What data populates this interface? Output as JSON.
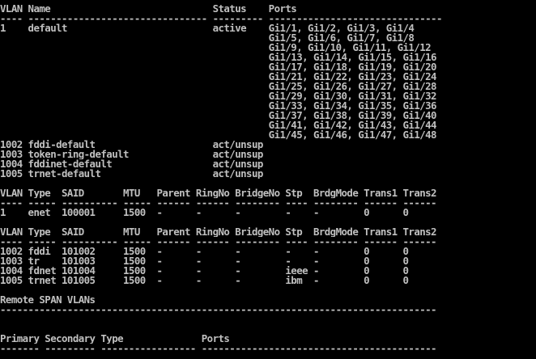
{
  "terminal": {
    "lines": [
      "VLAN Name                             Status    Ports",
      "---- -------------------------------- --------- -------------------------------",
      "1    default                          active    Gi1/1, Gi1/2, Gi1/3, Gi1/4",
      "                                                Gi1/5, Gi1/6, Gi1/7, Gi1/8",
      "                                                Gi1/9, Gi1/10, Gi1/11, Gi1/12",
      "                                                Gi1/13, Gi1/14, Gi1/15, Gi1/16",
      "                                                Gi1/17, Gi1/18, Gi1/19, Gi1/20",
      "                                                Gi1/21, Gi1/22, Gi1/23, Gi1/24",
      "                                                Gi1/25, Gi1/26, Gi1/27, Gi1/28",
      "                                                Gi1/29, Gi1/30, Gi1/31, Gi1/32",
      "                                                Gi1/33, Gi1/34, Gi1/35, Gi1/36",
      "                                                Gi1/37, Gi1/38, Gi1/39, Gi1/40",
      "                                                Gi1/41, Gi1/42, Gi1/43, Gi1/44",
      "                                                Gi1/45, Gi1/46, Gi1/47, Gi1/48",
      "1002 fddi-default                     act/unsup",
      "1003 token-ring-default               act/unsup",
      "1004 fddinet-default                  act/unsup",
      "1005 trnet-default                    act/unsup",
      "",
      "VLAN Type  SAID       MTU   Parent RingNo BridgeNo Stp  BrdgMode Trans1 Trans2",
      "---- ----- ---------- ----- ------ ------ -------- ---- -------- ------ ------",
      "1    enet  100001     1500  -      -      -        -    -        0      0",
      "",
      "VLAN Type  SAID       MTU   Parent RingNo BridgeNo Stp  BrdgMode Trans1 Trans2",
      "---- ----- ---------- ----- ------ ------ -------- ---- -------- ------ ------",
      "1002 fddi  101002     1500  -      -      -        -    -        0      0",
      "1003 tr    101003     1500  -      -      -        -    -        0      0",
      "1004 fdnet 101004     1500  -      -      -        ieee -        0      0",
      "1005 trnet 101005     1500  -      -      -        ibm  -        0      0",
      "",
      "Remote SPAN VLANs",
      "------------------------------------------------------------------------------",
      "",
      "",
      "Primary Secondary Type              Ports",
      "------- --------- ----------------- ------------------------------------------"
    ]
  }
}
